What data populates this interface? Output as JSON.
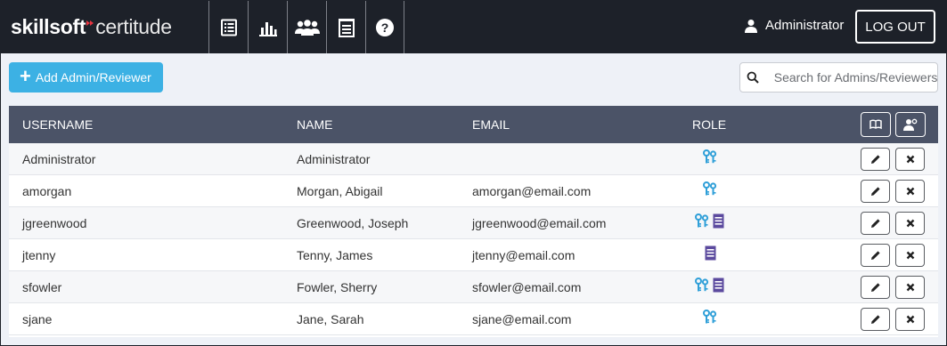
{
  "header": {
    "logo_brand": "skillsoft",
    "logo_product": "certitude",
    "nav_icons": [
      "list-icon",
      "bar-chart-icon",
      "users-icon",
      "document-icon",
      "help-icon"
    ],
    "user_name": "Administrator",
    "logout_label": "LOG OUT"
  },
  "toolbar": {
    "add_label": "Add Admin/Reviewer",
    "search_placeholder": "Search for Admins/Reviewers"
  },
  "table": {
    "columns": [
      "USERNAME",
      "NAME",
      "EMAIL",
      "ROLE"
    ],
    "rows": [
      {
        "username": "Administrator",
        "name": "Administrator",
        "email": "",
        "roles": [
          "admin"
        ]
      },
      {
        "username": "amorgan",
        "name": "Morgan, Abigail",
        "email": "amorgan@email.com",
        "roles": [
          "admin"
        ]
      },
      {
        "username": "jgreenwood",
        "name": "Greenwood, Joseph",
        "email": "jgreenwood@email.com",
        "roles": [
          "admin",
          "reviewer"
        ]
      },
      {
        "username": "jtenny",
        "name": "Tenny, James",
        "email": "jtenny@email.com",
        "roles": [
          "reviewer"
        ]
      },
      {
        "username": "sfowler",
        "name": "Fowler, Sherry",
        "email": "sfowler@email.com",
        "roles": [
          "admin",
          "reviewer"
        ]
      },
      {
        "username": "sjane",
        "name": "Jane, Sarah",
        "email": "sjane@email.com",
        "roles": [
          "admin"
        ]
      }
    ]
  },
  "colors": {
    "topbar": "#1d2129",
    "accent": "#3cb1e4",
    "table_header": "#4b5367",
    "admin_role": "#2f9fd8",
    "reviewer_role": "#5b4a9e"
  }
}
